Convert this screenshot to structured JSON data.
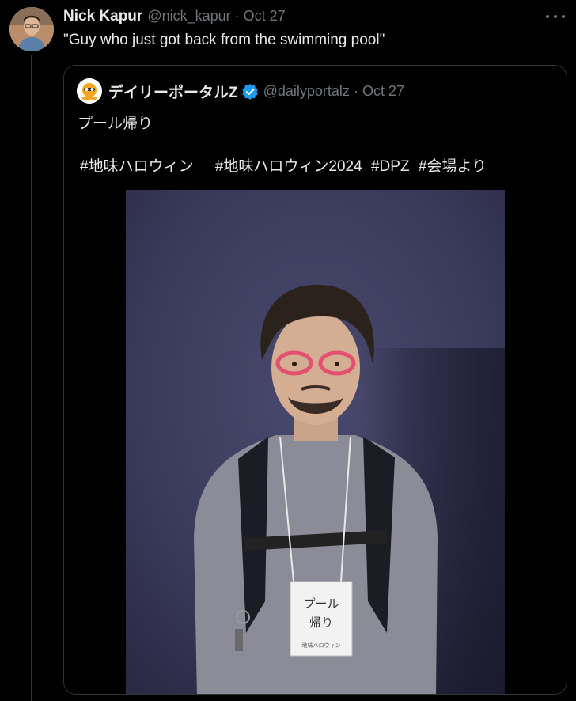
{
  "tweet": {
    "author_name": "Nick Kapur",
    "author_handle": "@nick_kapur",
    "separator": "·",
    "date": "Oct 27",
    "text": "\"Guy who just got back from the swimming pool\"",
    "avatar_icon": "profile-photo"
  },
  "quote": {
    "author_name": "デイリーポータルZ",
    "verified": true,
    "author_handle": "@dailyportalz",
    "separator": "·",
    "date": "Oct 27",
    "line1": "プール帰り",
    "hashtags": [
      "#地味ハロウィン",
      "#地味ハロウィン2024",
      "#DPZ",
      "#会場より"
    ],
    "photo": {
      "name_tag_line1": "プール",
      "name_tag_line2": "帰り",
      "name_tag_small": "地味ハロウィン"
    }
  },
  "colors": {
    "background": "#000000",
    "text": "#e7e9ea",
    "muted": "#71767b",
    "border": "#2f3336",
    "verified": "#1d9bf0"
  }
}
